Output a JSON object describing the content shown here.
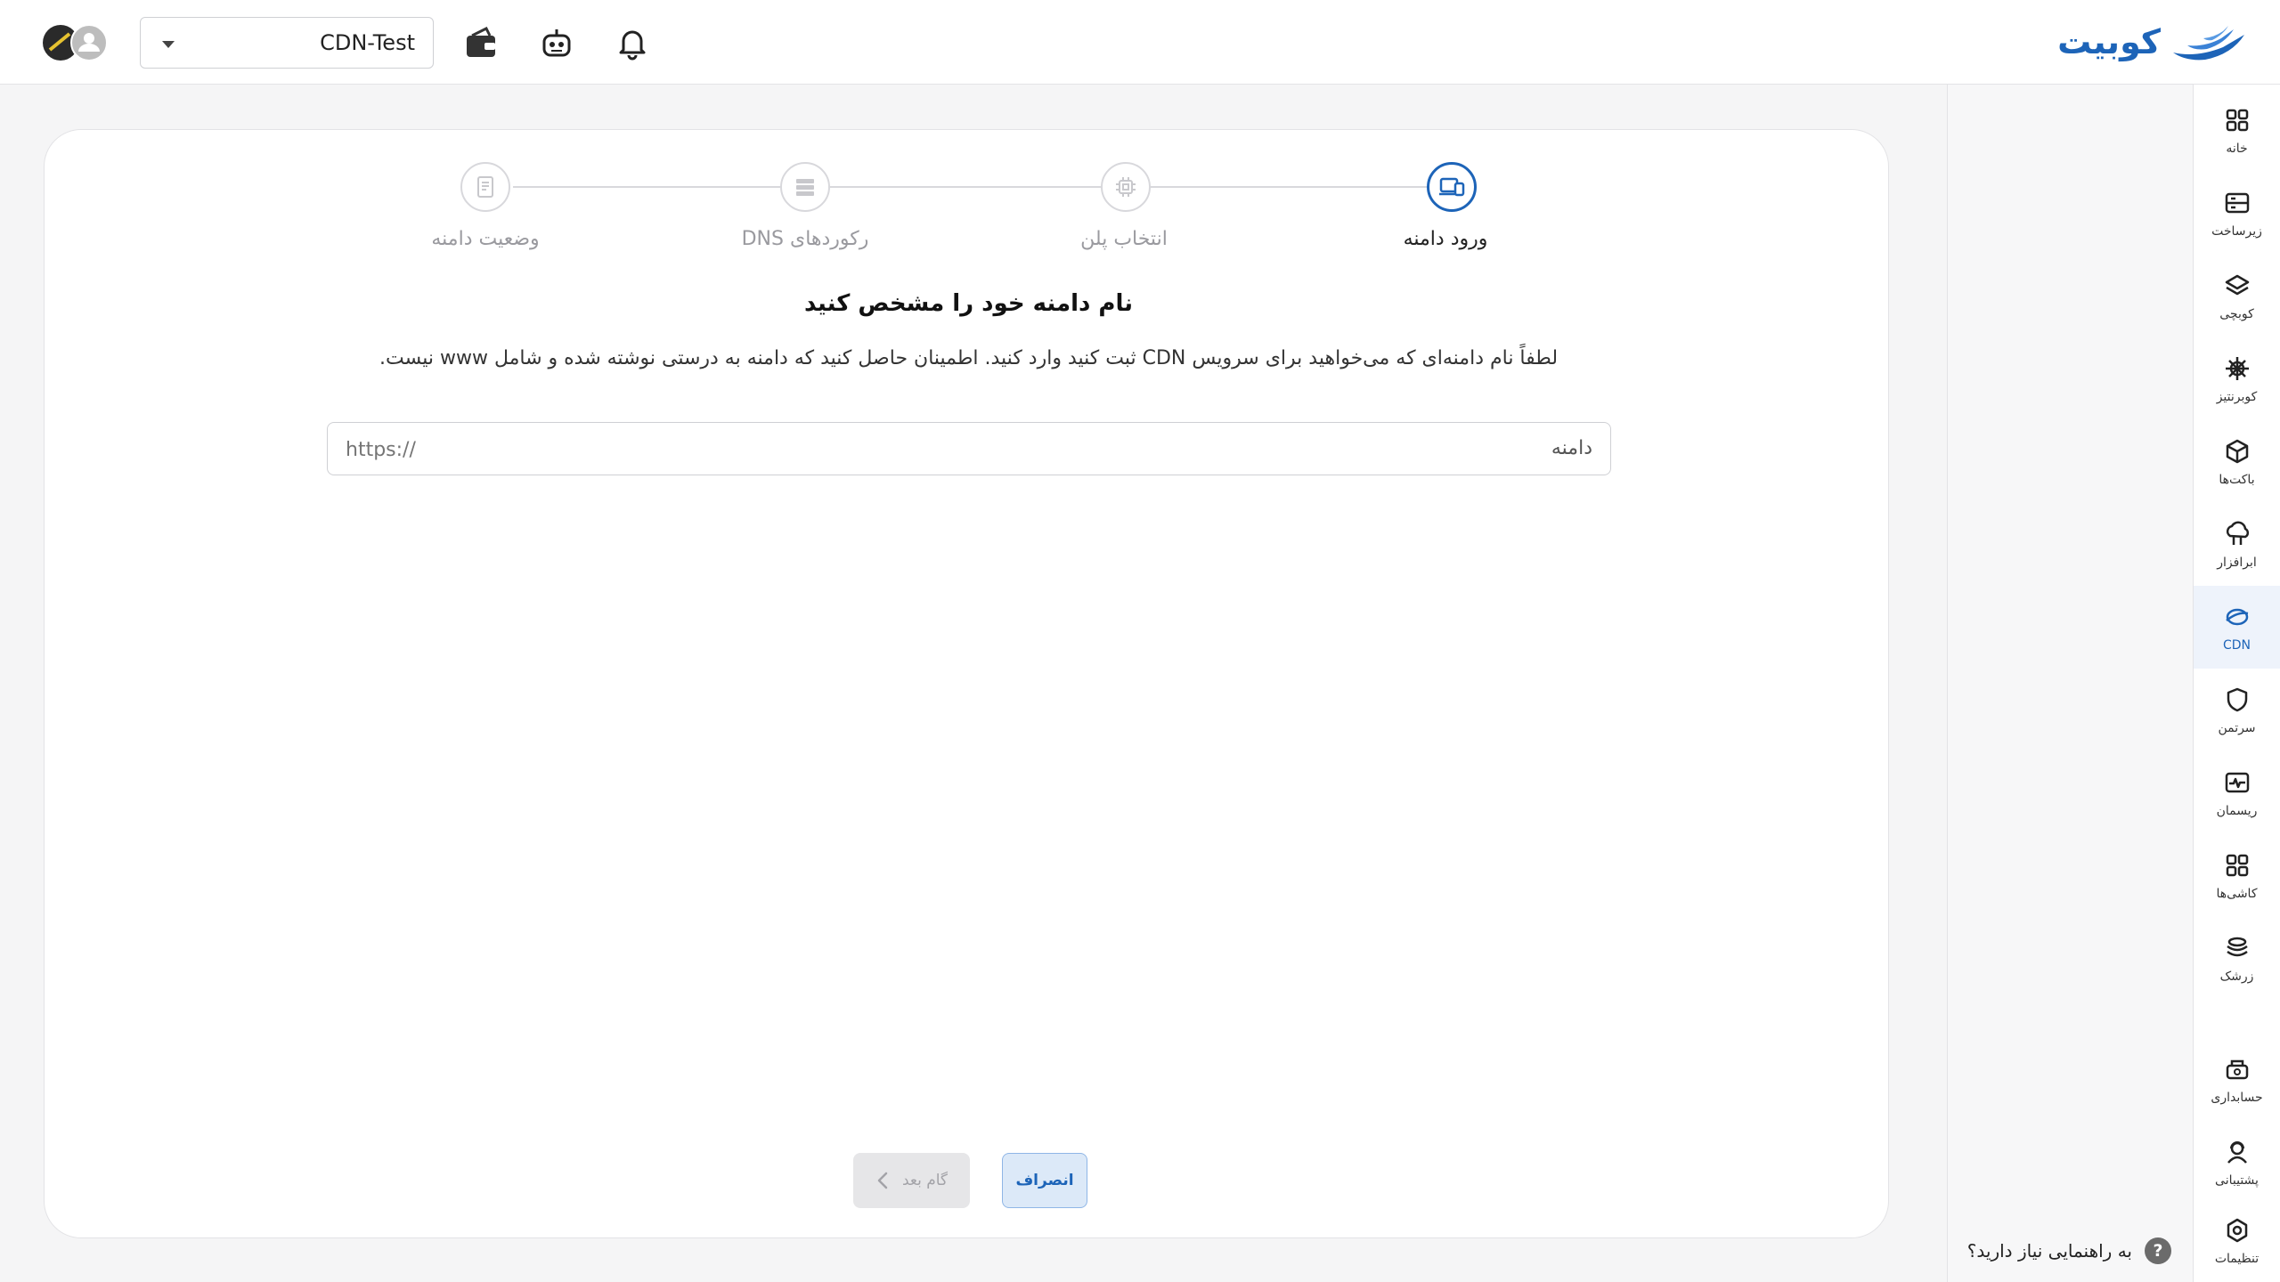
{
  "brand": {
    "name": "کوبیت",
    "color": "#1d64b8"
  },
  "topbar": {
    "project_select": {
      "value": "CDN-Test",
      "icon": "chevron-down-icon"
    },
    "icons": [
      "wallet-icon",
      "robot-icon",
      "bell-icon",
      "avatar-icon"
    ]
  },
  "sidebar": {
    "items": [
      {
        "label": "خانه",
        "icon": "grid-icon"
      },
      {
        "label": "زیرساخت",
        "icon": "server-icon"
      },
      {
        "label": "کوبچی",
        "icon": "layers-icon"
      },
      {
        "label": "کوبرنتیز",
        "icon": "helm-icon"
      },
      {
        "label": "باکت‌ها",
        "icon": "box-icon"
      },
      {
        "label": "ابرافزار",
        "icon": "cloud-app-icon"
      },
      {
        "label": "CDN",
        "icon": "globe-icon",
        "active": true
      },
      {
        "label": "سرتمن",
        "icon": "shield-icon"
      },
      {
        "label": "ریسمان",
        "icon": "pulse-icon"
      },
      {
        "label": "کاشی‌ها",
        "icon": "tiles-icon"
      },
      {
        "label": "زرشک",
        "icon": "stack-icon"
      }
    ],
    "bottom_items": [
      {
        "label": "حسابداری",
        "icon": "accounting-icon"
      },
      {
        "label": "پشتیبانی",
        "icon": "support-icon"
      },
      {
        "label": "تنظیمات",
        "icon": "settings-icon"
      }
    ],
    "active_color": "#1d64b8"
  },
  "help": {
    "text": "به راهنمایی نیاز دارید؟",
    "icon": "?"
  },
  "stepper": {
    "steps": [
      {
        "label": "ورود دامنه",
        "icon": "devices-icon",
        "active": true
      },
      {
        "label": "انتخاب پلن",
        "icon": "chip-icon"
      },
      {
        "label": "رکوردهای DNS",
        "icon": "records-icon"
      },
      {
        "label": "وضعیت دامنه",
        "icon": "document-icon"
      }
    ]
  },
  "form": {
    "heading": "نام دامنه خود را مشخص کنید",
    "description": "لطفاً نام دامنه‌ای که می‌خواهید برای سرویس CDN ثبت کنید وارد کنید. اطمینان حاصل کنید که دامنه به درستی نوشته شده و شامل www نیست.",
    "domain_label": "دامنه",
    "domain_placeholder": "https://"
  },
  "actions": {
    "cancel_label": "انصراف",
    "next_label": "گام بعد",
    "next_disabled": true
  }
}
